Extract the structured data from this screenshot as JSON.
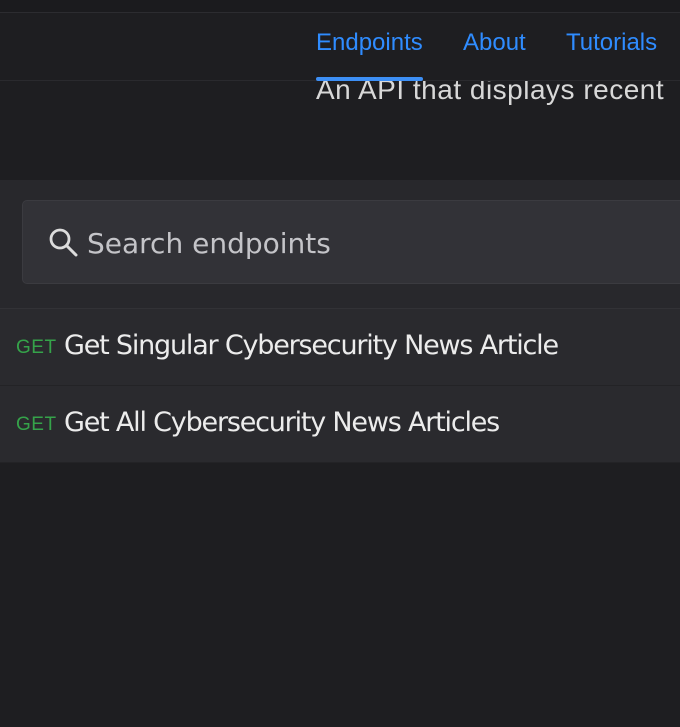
{
  "nav": {
    "tabs": [
      {
        "label": "Endpoints",
        "active": true
      },
      {
        "label": "About",
        "active": false
      },
      {
        "label": "Tutorials",
        "active": false
      }
    ],
    "accent_color": "#2f8cff"
  },
  "header": {
    "description": "An API that displays recent"
  },
  "search": {
    "placeholder": "Search endpoints",
    "icon": "search-icon"
  },
  "endpoints": [
    {
      "method": "GET",
      "name": "Get Singular Cybersecurity News Article"
    },
    {
      "method": "GET",
      "name": "Get All Cybersecurity News Articles"
    }
  ],
  "colors": {
    "background": "#1e1e21",
    "method_get": "#35a34a"
  }
}
